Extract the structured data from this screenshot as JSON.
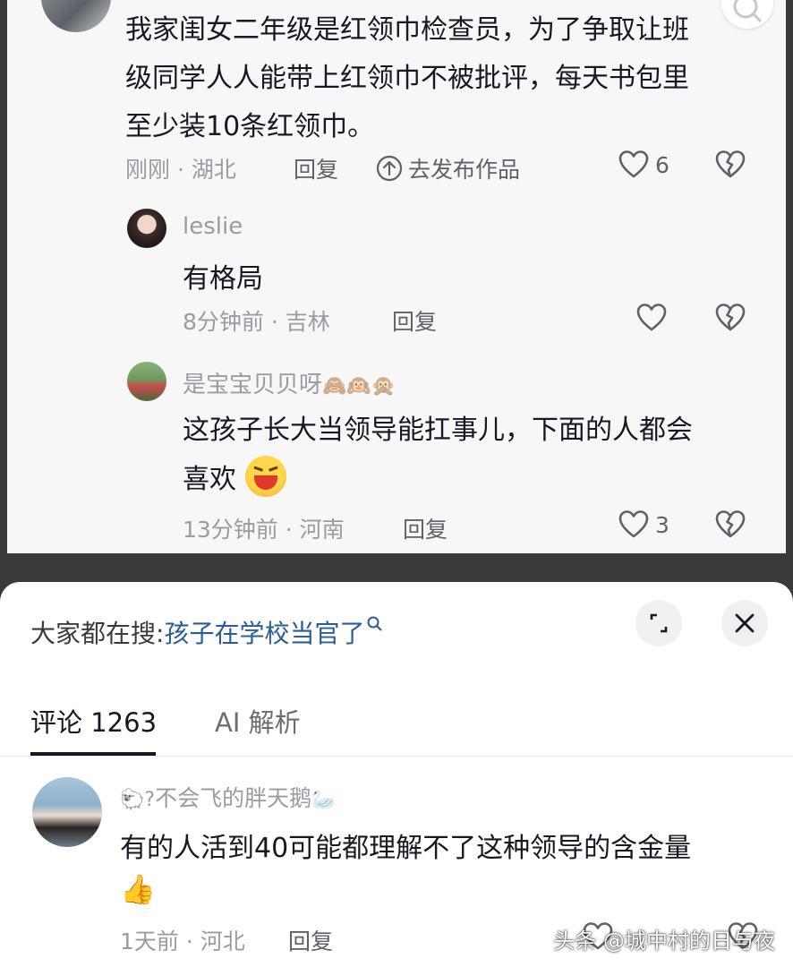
{
  "top": {
    "comment1": {
      "text_line1": "我家闺女二年级是红领巾检查员，为了争取让班",
      "text_line2": "级同学人人能带上红领巾不被批评，每天书包里",
      "text_line3": "至少装10条红领巾。",
      "time": "刚刚",
      "location": "湖北",
      "reply_label": "回复",
      "publish_label": "去发布作品",
      "likes": "6"
    },
    "reply1": {
      "username": "leslie",
      "text": "有格局",
      "time": "8分钟前",
      "location": "吉林",
      "reply_label": "回复"
    },
    "reply2": {
      "username": "是宝宝贝贝呀",
      "username_emoji": "🙈🙉🙊",
      "text_line1": "这孩子长大当领导能扛事儿，下面的人都会",
      "text_line2": "喜欢",
      "text_emoji": "😆",
      "time": "13分钟前",
      "location": "河南",
      "reply_label": "回复",
      "likes": "3"
    }
  },
  "sheet": {
    "search_prefix": "大家都在搜:",
    "search_term": "孩子在学校当官了",
    "tabs": [
      {
        "label": "评论 1263",
        "active": true
      },
      {
        "label": "AI 解析",
        "active": false
      }
    ],
    "comment": {
      "username": "不会飞的胖天鹅",
      "name_prefix": "🐑?",
      "name_suffix": "🦢",
      "text_line1": "有的人活到40可能都理解不了这种领导的含金量",
      "text_emoji": "👍",
      "time": "1天前",
      "location": "河北",
      "reply_label": "回复"
    }
  },
  "watermark": "头条 @城中村的日与夜",
  "colors": {
    "link": "#2a5c9a",
    "text": "#161823",
    "meta": "#9a9ca3"
  }
}
